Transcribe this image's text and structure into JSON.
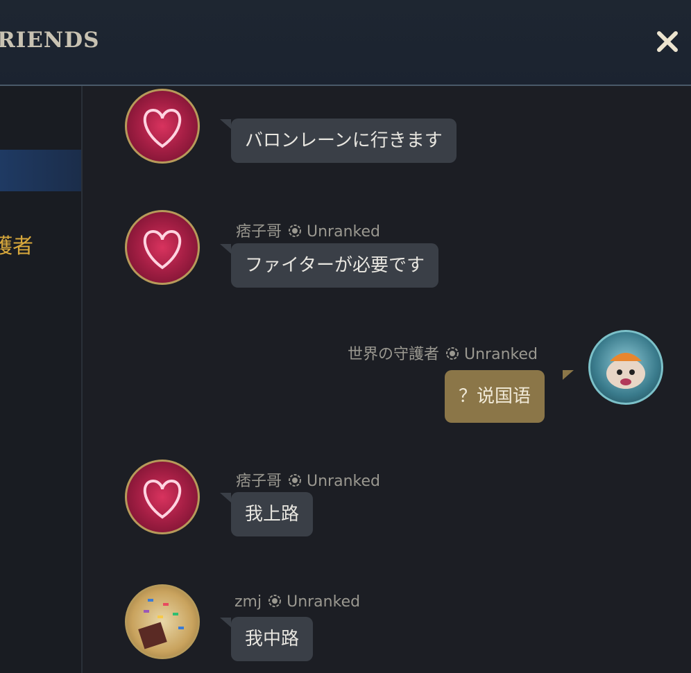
{
  "header": {
    "title": "RIENDS",
    "close_icon": "close-icon"
  },
  "sidebar": {
    "selected_friend_name": "護者"
  },
  "messages": [
    {
      "avatar": "heart-avatar",
      "username": "",
      "rank": "",
      "text": "バロンレーンに行きます"
    },
    {
      "avatar": "heart-avatar",
      "username": "痞子哥",
      "rank": "Unranked",
      "text": "ファイターが必要です"
    },
    {
      "avatar": "poro-avatar",
      "username": "世界の守護者",
      "rank": "Unranked",
      "text": "？说国语",
      "mine": true
    },
    {
      "avatar": "heart-avatar",
      "username": "痞子哥",
      "rank": "Unranked",
      "text": "我上路"
    },
    {
      "avatar": "confetti-avatar",
      "username": "zmj",
      "rank": "Unranked",
      "text": "我中路"
    }
  ],
  "colors": {
    "accent_gold": "#d9a93c",
    "my_bubble": "#8b7648",
    "other_bubble": "#3a3f47"
  }
}
